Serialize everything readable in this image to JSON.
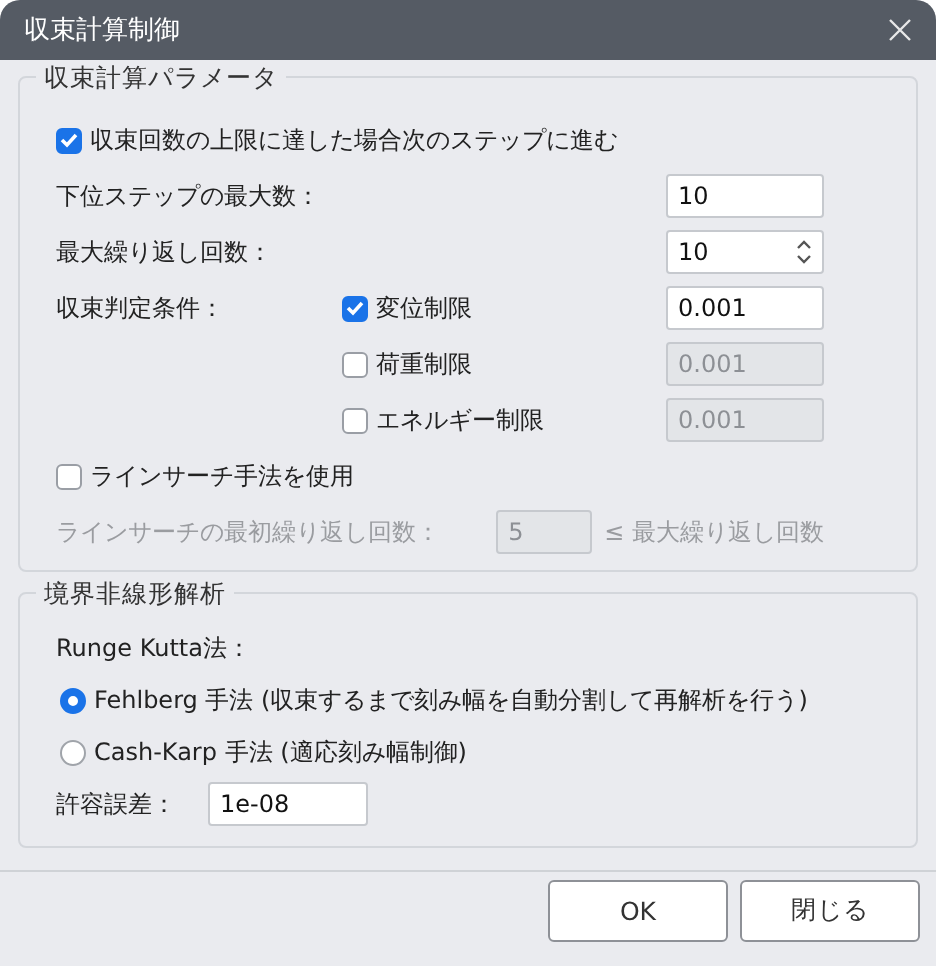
{
  "window": {
    "title": "収束計算制御"
  },
  "convergence": {
    "title": "収束計算パラメータ",
    "advance": {
      "label": "収束回数の上限に達した場合次のステップに進む",
      "checked": true
    },
    "max_substeps": {
      "label": "下位ステップの最大数：",
      "value": "10"
    },
    "max_iterations": {
      "label": "最大繰り返し回数：",
      "value": "10"
    },
    "criteria_label": "収束判定条件：",
    "criteria": [
      {
        "label": "変位制限",
        "checked": true,
        "value": "0.001",
        "disabled": false
      },
      {
        "label": "荷重制限",
        "checked": false,
        "value": "0.001",
        "disabled": true
      },
      {
        "label": "エネルギー制限",
        "checked": false,
        "value": "0.001",
        "disabled": true
      }
    ],
    "line_search": {
      "label": "ラインサーチ手法を使用",
      "checked": false
    },
    "line_search_initial": {
      "label": "ラインサーチの最初繰り返し回数：",
      "value": "5",
      "suffix": "≤ 最大繰り返し回数",
      "disabled": true
    }
  },
  "boundary": {
    "title": "境界非線形解析",
    "method_label": "Runge Kutta法：",
    "methods": [
      {
        "label": "Fehlberg 手法 (収束するまで刻み幅を自動分割して再解析を行う)",
        "selected": true
      },
      {
        "label": "Cash-Karp 手法 (適応刻み幅制御)",
        "selected": false
      }
    ],
    "tolerance": {
      "label": "許容誤差：",
      "value": "1e-08"
    }
  },
  "buttons": [
    {
      "label": "OK"
    },
    {
      "label": "閉じる"
    }
  ]
}
